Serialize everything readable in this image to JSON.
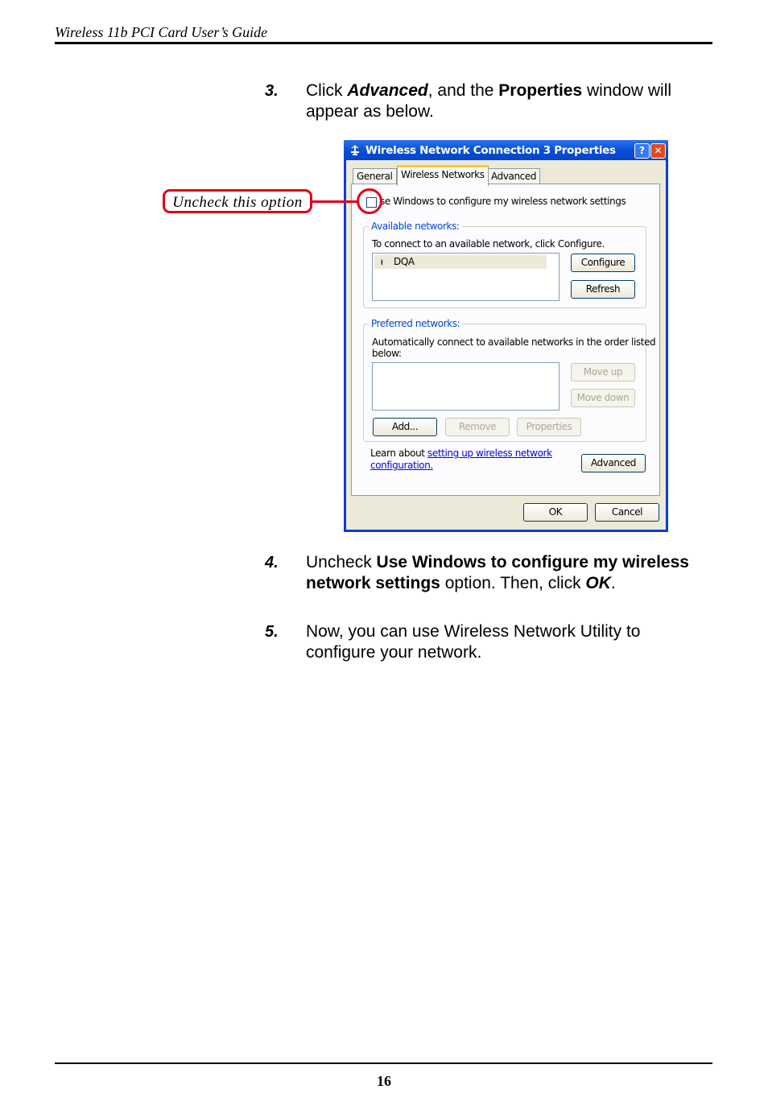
{
  "page": {
    "header": "Wireless 11b PCI Card User’s Guide",
    "page_number": "16"
  },
  "steps": [
    {
      "num": "3.",
      "pre": "Click ",
      "b1": "Advanced",
      "mid": ", and the ",
      "b2": "Properties",
      "post": " window will appear as below."
    },
    {
      "num": "4.",
      "pre": "Uncheck ",
      "b1": "Use Windows to configure my wireless network settings",
      "mid": " option.  Then, click ",
      "b2": "OK",
      "post": "."
    },
    {
      "num": "5.",
      "text": "Now, you can use Wireless Network Utility to configure your network."
    }
  ],
  "callout": {
    "text": "Uncheck this option"
  },
  "dialog": {
    "title": "Wireless Network Connection 3 Properties",
    "help_btn": "?",
    "close_btn": "✕",
    "tabs": [
      "General",
      "Wireless Networks",
      "Advanced"
    ],
    "use_windows_label": "se Windows to configure my wireless network settings",
    "available": {
      "title": "Available networks:",
      "desc": "To connect to an available network, click Configure.",
      "items": [
        "DQA"
      ],
      "configure": "Configure",
      "refresh": "Refresh"
    },
    "preferred": {
      "title": "Preferred networks:",
      "desc1": "Automatically connect to available networks in the order listed",
      "desc2": "below:",
      "move_up": "Move up",
      "move_down": "Move down",
      "add": "Add...",
      "remove": "Remove",
      "properties": "Properties"
    },
    "learn": {
      "prefix": "Learn about ",
      "link1": "setting up wireless network",
      "link2": "configuration."
    },
    "advanced_btn": "Advanced",
    "ok": "OK",
    "cancel": "Cancel"
  }
}
